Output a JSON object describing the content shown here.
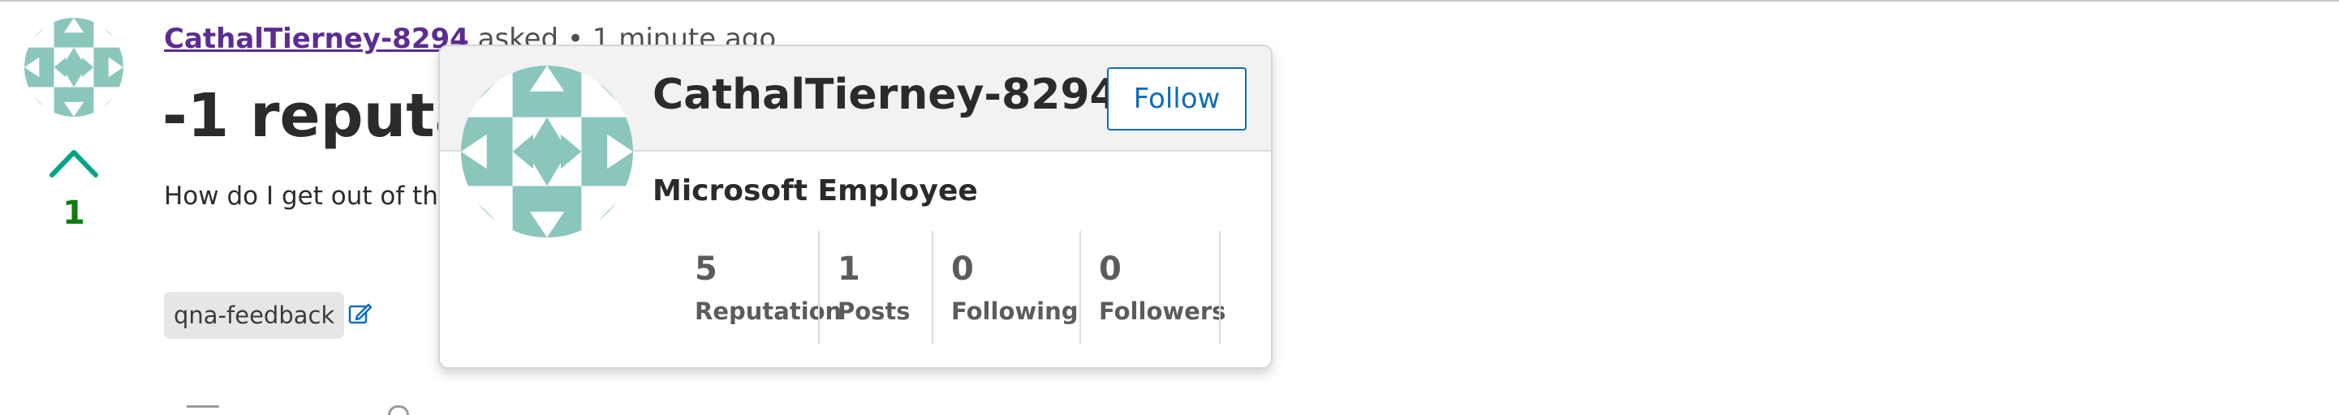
{
  "question": {
    "author": "CathalTierney-8294",
    "asked_text": "asked • 1 minute ago",
    "title_visible": "-1 reputat",
    "body_visible": "How do I get out of th",
    "vote_count": "1",
    "tags": [
      "qna-feedback"
    ]
  },
  "hover_card": {
    "name": "CathalTierney-8294",
    "follow_label": "Follow",
    "role": "Microsoft Employee",
    "stats": [
      {
        "value": "5",
        "label": "Reputation"
      },
      {
        "value": "1",
        "label": "Posts"
      },
      {
        "value": "0",
        "label": "Following"
      },
      {
        "value": "0",
        "label": "Followers"
      }
    ]
  },
  "colors": {
    "author_link": "#5c2d91",
    "vote_up": "#00a586",
    "vote_count": "#107c10",
    "follow_accent": "#0f6cbd",
    "identicon": "#8bc6bd"
  },
  "icons": {
    "avatar": "identicon-avatar",
    "vote": "upvote-chevron-icon",
    "tag_edit": "edit-icon"
  }
}
